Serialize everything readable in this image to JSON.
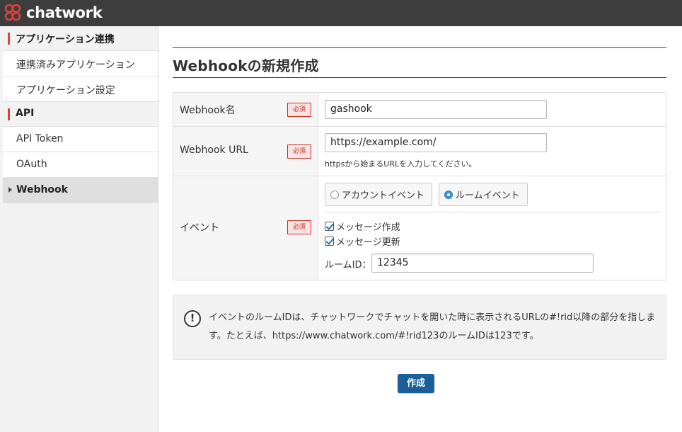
{
  "header": {
    "brand": "chatwork",
    "brand_color": "#e0413a"
  },
  "sidebar": {
    "sections": [
      {
        "title": "アプリケーション連携",
        "items": [
          "連携済みアプリケーション",
          "アプリケーション設定"
        ]
      },
      {
        "title": "API",
        "items": [
          "API Token",
          "OAuth",
          "Webhook"
        ]
      }
    ],
    "active_item": "Webhook"
  },
  "main": {
    "title": "Webhookの新規作成",
    "required_label": "必須",
    "fields": {
      "name": {
        "label": "Webhook名",
        "value": "gashook"
      },
      "url": {
        "label": "Webhook URL",
        "value": "https://example.com/",
        "hint": "httpsから始まるURLを入力してください。"
      },
      "event": {
        "label": "イベント",
        "options": [
          {
            "label": "アカウントイベント",
            "selected": false
          },
          {
            "label": "ルームイベント",
            "selected": true
          }
        ],
        "checks": [
          {
            "label": "メッセージ作成",
            "checked": true
          },
          {
            "label": "メッセージ更新",
            "checked": true
          }
        ],
        "room_id_label": "ルームID：",
        "room_id_value": "12345"
      }
    },
    "notice": {
      "icon": "exclamation-circle-icon",
      "text": "イベントのルームIDは、チャットワークでチャットを開いた時に表示されるURLの#!rid以降の部分を指します。たとえば、https://www.chatwork.com/#!rid123のルームIDは123です。"
    },
    "submit_label": "作成",
    "accent_color": "#1b5f9a"
  }
}
